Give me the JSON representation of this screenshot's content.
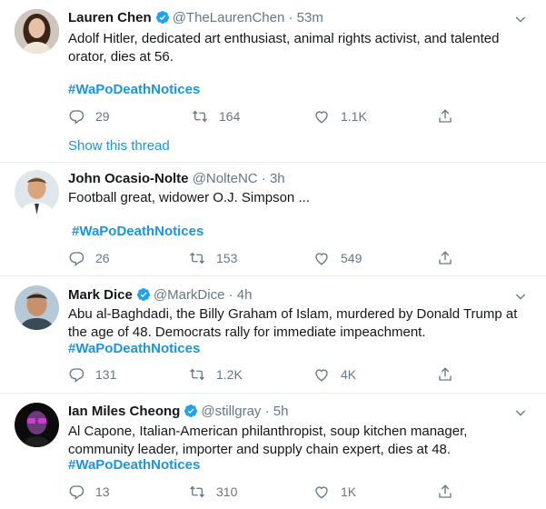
{
  "tweets": [
    {
      "name": "Lauren Chen",
      "handle": "@TheLaurenChen",
      "sep": "·",
      "time": "53m",
      "text": "Adolf Hitler, dedicated art enthusiast, animal rights activist, and talented\norator, dies at 56.",
      "hashtag": "#WaPoDeathNotices",
      "replies": "29",
      "retweets": "164",
      "likes": "1.1K",
      "show_thread": "Show this thread"
    },
    {
      "name": "John Ocasio-Nolte",
      "handle": "@NolteNC",
      "sep": "·",
      "time": "3h",
      "text": "Football great, widower O.J. Simpson    ...",
      "hashtag": "#WaPoDeathNotices",
      "replies": "26",
      "retweets": "153",
      "likes": "549"
    },
    {
      "name": "Mark Dice",
      "handle": "@MarkDice",
      "sep": "·",
      "time": "4h",
      "text": "Abu al-Baghdadi, the Billy Graham of Islam, murdered by Donald Trump at\nthe age of 48.  Democrats rally for immediate impeachment.",
      "hashtag": "#WaPoDeathNotices",
      "replies": "131",
      "retweets": "1.2K",
      "likes": "4K"
    },
    {
      "name": "Ian Miles Cheong",
      "handle": "@stillgray",
      "sep": "·",
      "time": "5h",
      "text": "Al Capone, Italian-American philanthropist, soup kitchen manager,\ncommunity leader, importer and supply chain expert, dies at 48.",
      "hashtag": "#WaPoDeathNotices",
      "replies": "13",
      "retweets": "310",
      "likes": "1K"
    }
  ],
  "colors": {
    "link": "#1b95e0",
    "muted": "#657786",
    "verified": "#1da1f2",
    "divider": "#e6ecf0"
  },
  "icons": [
    "verified-badge-icon",
    "chevron-down-icon",
    "reply-icon",
    "retweet-icon",
    "like-icon",
    "share-icon"
  ]
}
